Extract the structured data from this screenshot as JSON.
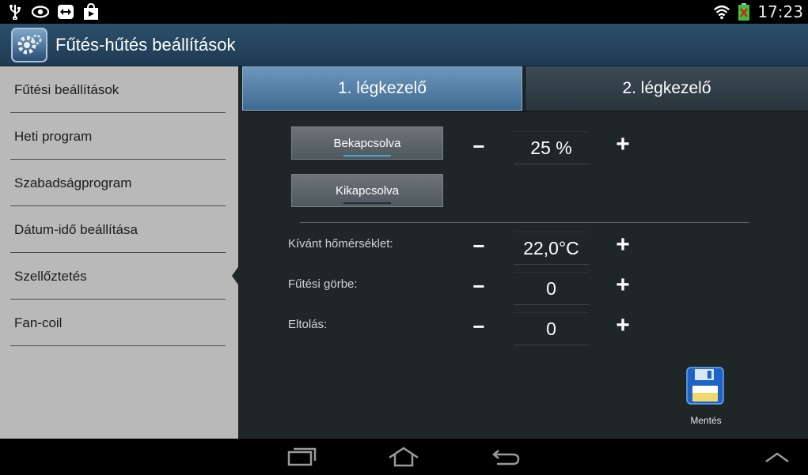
{
  "status_bar": {
    "icons": [
      "usb-icon",
      "eye-icon",
      "teamviewer-icon",
      "play-store-icon",
      "wifi-icon",
      "battery-icon"
    ],
    "time": "17:23"
  },
  "app": {
    "title": "Fűtés-hűtés beállítások"
  },
  "sidebar": {
    "items": [
      {
        "label": "Fűtési beállítások"
      },
      {
        "label": "Heti program"
      },
      {
        "label": "Szabadságprogram"
      },
      {
        "label": "Dátum-idő beállítása"
      },
      {
        "label": "Szellőztetés"
      },
      {
        "label": "Fan-coil"
      }
    ],
    "selected_index": 4
  },
  "tabs": [
    {
      "label": "1. légkezelő",
      "active": true
    },
    {
      "label": "2. légkezelő",
      "active": false
    }
  ],
  "power": {
    "on_label": "Bekapcsolva",
    "off_label": "Kikapcsolva",
    "on_active": true
  },
  "fan": {
    "minus": "−",
    "plus": "+",
    "value": "25 %"
  },
  "settings": [
    {
      "label": "Kívánt hőmérséklet:",
      "value": "22,0°C",
      "minus": "−",
      "plus": "+"
    },
    {
      "label": "Fűtési görbe:",
      "value": "0",
      "minus": "−",
      "plus": "+"
    },
    {
      "label": "Eltolás:",
      "value": "0",
      "minus": "−",
      "plus": "+"
    }
  ],
  "save": {
    "label": "Mentés"
  },
  "colors": {
    "accent": "#3fa9e0",
    "tab_active": "#5b84ab",
    "sidebar_bg": "#b9b9b9",
    "content_bg": "#1f2628"
  }
}
